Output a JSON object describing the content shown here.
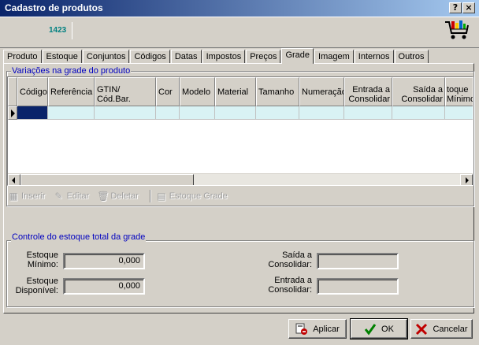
{
  "window": {
    "title": "Cadastro de produtos",
    "help_label": "?",
    "close_label": "×"
  },
  "header": {
    "product_code": "1423",
    "cart_icon": "shopping-cart-icon"
  },
  "tabs": [
    {
      "label": "Produto"
    },
    {
      "label": "Estoque"
    },
    {
      "label": "Conjuntos"
    },
    {
      "label": "Códigos"
    },
    {
      "label": "Datas"
    },
    {
      "label": "Impostos"
    },
    {
      "label": "Preços"
    },
    {
      "label": "Grade"
    },
    {
      "label": "Imagem"
    },
    {
      "label": "Internos"
    },
    {
      "label": "Outros"
    }
  ],
  "active_tab": "Grade",
  "grid_group": {
    "title": "Variações na grade do produto",
    "columns": [
      {
        "label": "Código"
      },
      {
        "label": "Referência"
      },
      {
        "label": "GTIN/ Cód.Bar."
      },
      {
        "label": "Cor"
      },
      {
        "label": "Modelo"
      },
      {
        "label": "Material"
      },
      {
        "label": "Tamanho"
      },
      {
        "label": "Numeração"
      },
      {
        "label": "Entrada a Consolidar"
      },
      {
        "label": "Saída a Consolidar"
      },
      {
        "label": "toque Mínimo"
      }
    ]
  },
  "toolbar": {
    "insert": "Inserir",
    "edit": "Editar",
    "delete": "Deletar",
    "grade_stock": "Estoque Grade"
  },
  "stock_group": {
    "title": "Controle do estoque total da grade",
    "min_label": "Estoque Mínimo:",
    "min_value": "0,000",
    "available_label": "Estoque Disponível:",
    "available_value": "0,000",
    "out_label": "Saída a Consolidar:",
    "out_value": "",
    "in_label": "Entrada a Consolidar:",
    "in_value": ""
  },
  "buttons": {
    "apply": "Aplicar",
    "ok": "OK",
    "cancel": "Cancelar"
  },
  "colors": {
    "title_bar": "#0a246a",
    "selected_cell": "#0a246a",
    "row_fill": "#d9f2f4",
    "group_title": "#0000c0"
  }
}
